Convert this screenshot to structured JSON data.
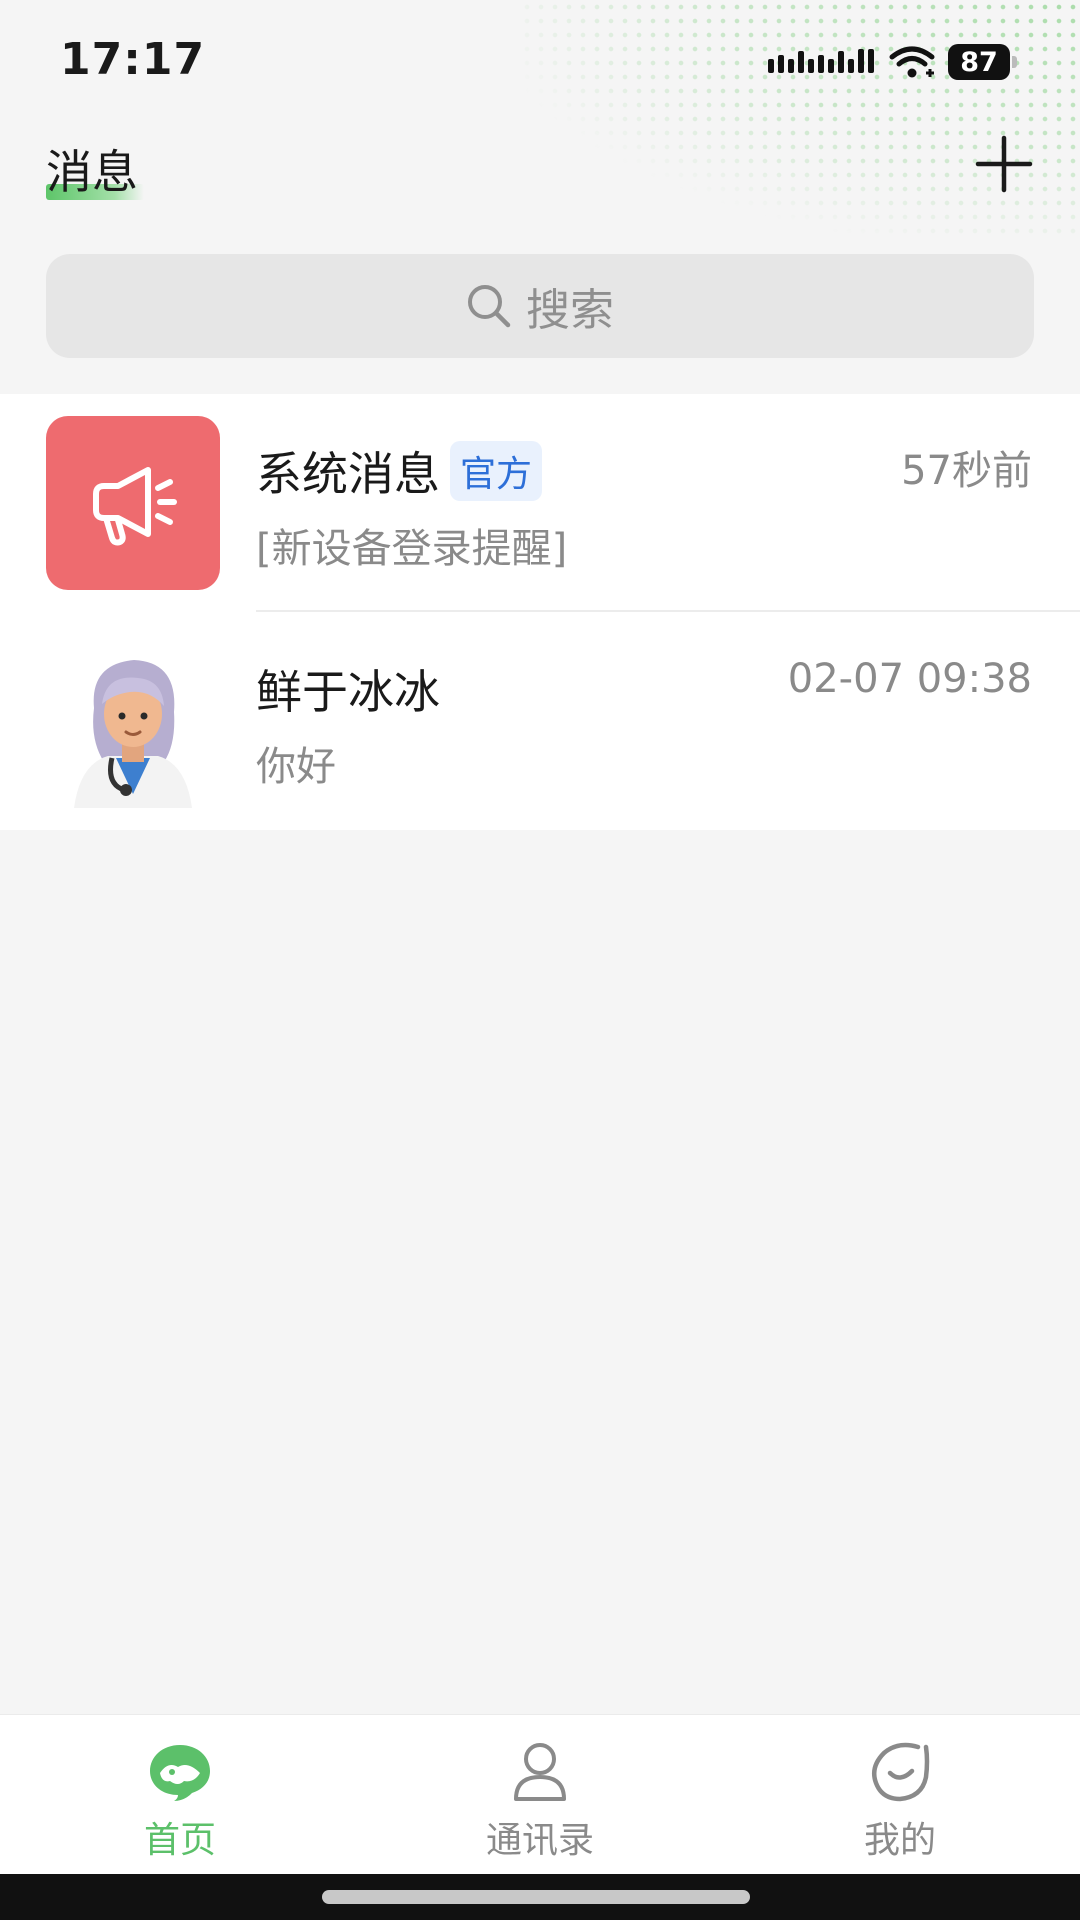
{
  "status_bar": {
    "time": "17:17",
    "battery": "87"
  },
  "header": {
    "title": "消息"
  },
  "search": {
    "placeholder": "搜索"
  },
  "conversations": [
    {
      "name": "系统消息",
      "badge": "官方",
      "time": "57秒前",
      "preview": "[新设备登录提醒]",
      "avatar_icon": "megaphone-icon",
      "avatar_color": "#ee6b6f"
    },
    {
      "name": "鲜于冰冰",
      "time": "02-07 09:38",
      "preview": "你好",
      "avatar_icon": "doctor-avatar"
    }
  ],
  "bottom_nav": [
    {
      "label": "首页",
      "icon": "chat-bubble-icon",
      "active": true
    },
    {
      "label": "通讯录",
      "icon": "person-icon",
      "active": false
    },
    {
      "label": "我的",
      "icon": "smile-icon",
      "active": false
    }
  ],
  "colors": {
    "accent": "#5cc06a",
    "badge_text": "#2d6fd8",
    "system_avatar": "#ee6b6f"
  }
}
